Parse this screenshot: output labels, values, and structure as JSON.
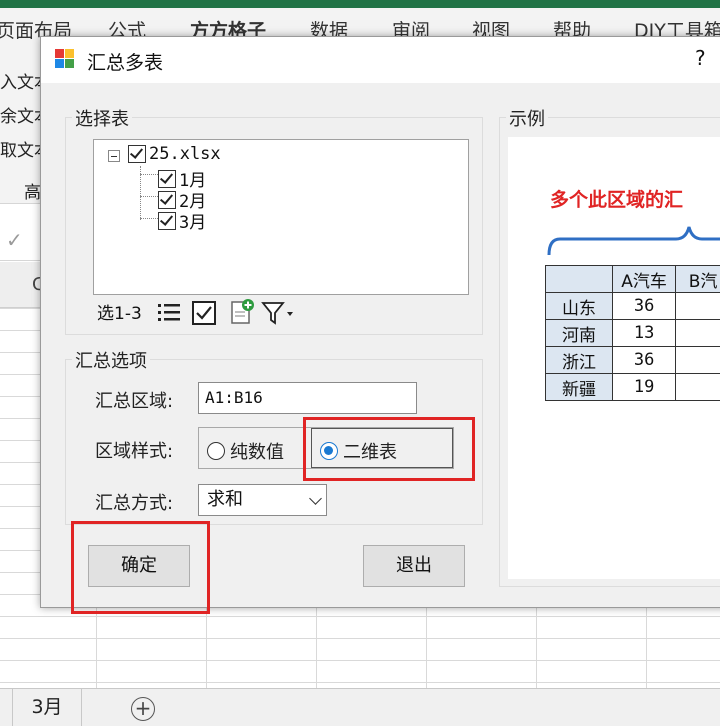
{
  "excel": {
    "menu": [
      "页面布局",
      "公式",
      "方方格子",
      "数据",
      "审阅",
      "视图",
      "帮助",
      "DIY工具箱"
    ],
    "ribbon_items": [
      "入文本",
      "余文本",
      "取文本",
      "高"
    ],
    "col_header_partial": "C",
    "sheet_tab": "3月",
    "add_sheet_symbol": "⊕",
    "check_symbol": "✓"
  },
  "dialog": {
    "title": "汇总多表",
    "help": "?",
    "select_sheets": {
      "legend": "选择表",
      "tree": {
        "root": "25.xlsx",
        "children": [
          "1月",
          "2月",
          "3月"
        ]
      },
      "toolbar": {
        "range_label": "选1-3"
      }
    },
    "options": {
      "legend": "汇总选项",
      "range_label": "汇总区域:",
      "range_value": "A1:B16",
      "style_label": "区域样式:",
      "style_options": [
        "纯数值",
        "二维表"
      ],
      "style_selected": "二维表",
      "method_label": "汇总方式:",
      "method_value": "求和"
    },
    "buttons": {
      "ok": "确定",
      "exit": "退出"
    },
    "example": {
      "legend": "示例",
      "note": "多个此区域的汇",
      "table": {
        "headers": [
          "",
          "A汽车",
          "B汽"
        ],
        "rows": [
          {
            "label": "山东",
            "value": "36"
          },
          {
            "label": "河南",
            "value": "13"
          },
          {
            "label": "浙江",
            "value": "36"
          },
          {
            "label": "新疆",
            "value": "19"
          }
        ]
      }
    }
  },
  "colors": {
    "excel_green": "#217346",
    "highlight_red": "#e02424",
    "radio_blue": "#1979d2",
    "table_header": "#dce6f1"
  }
}
